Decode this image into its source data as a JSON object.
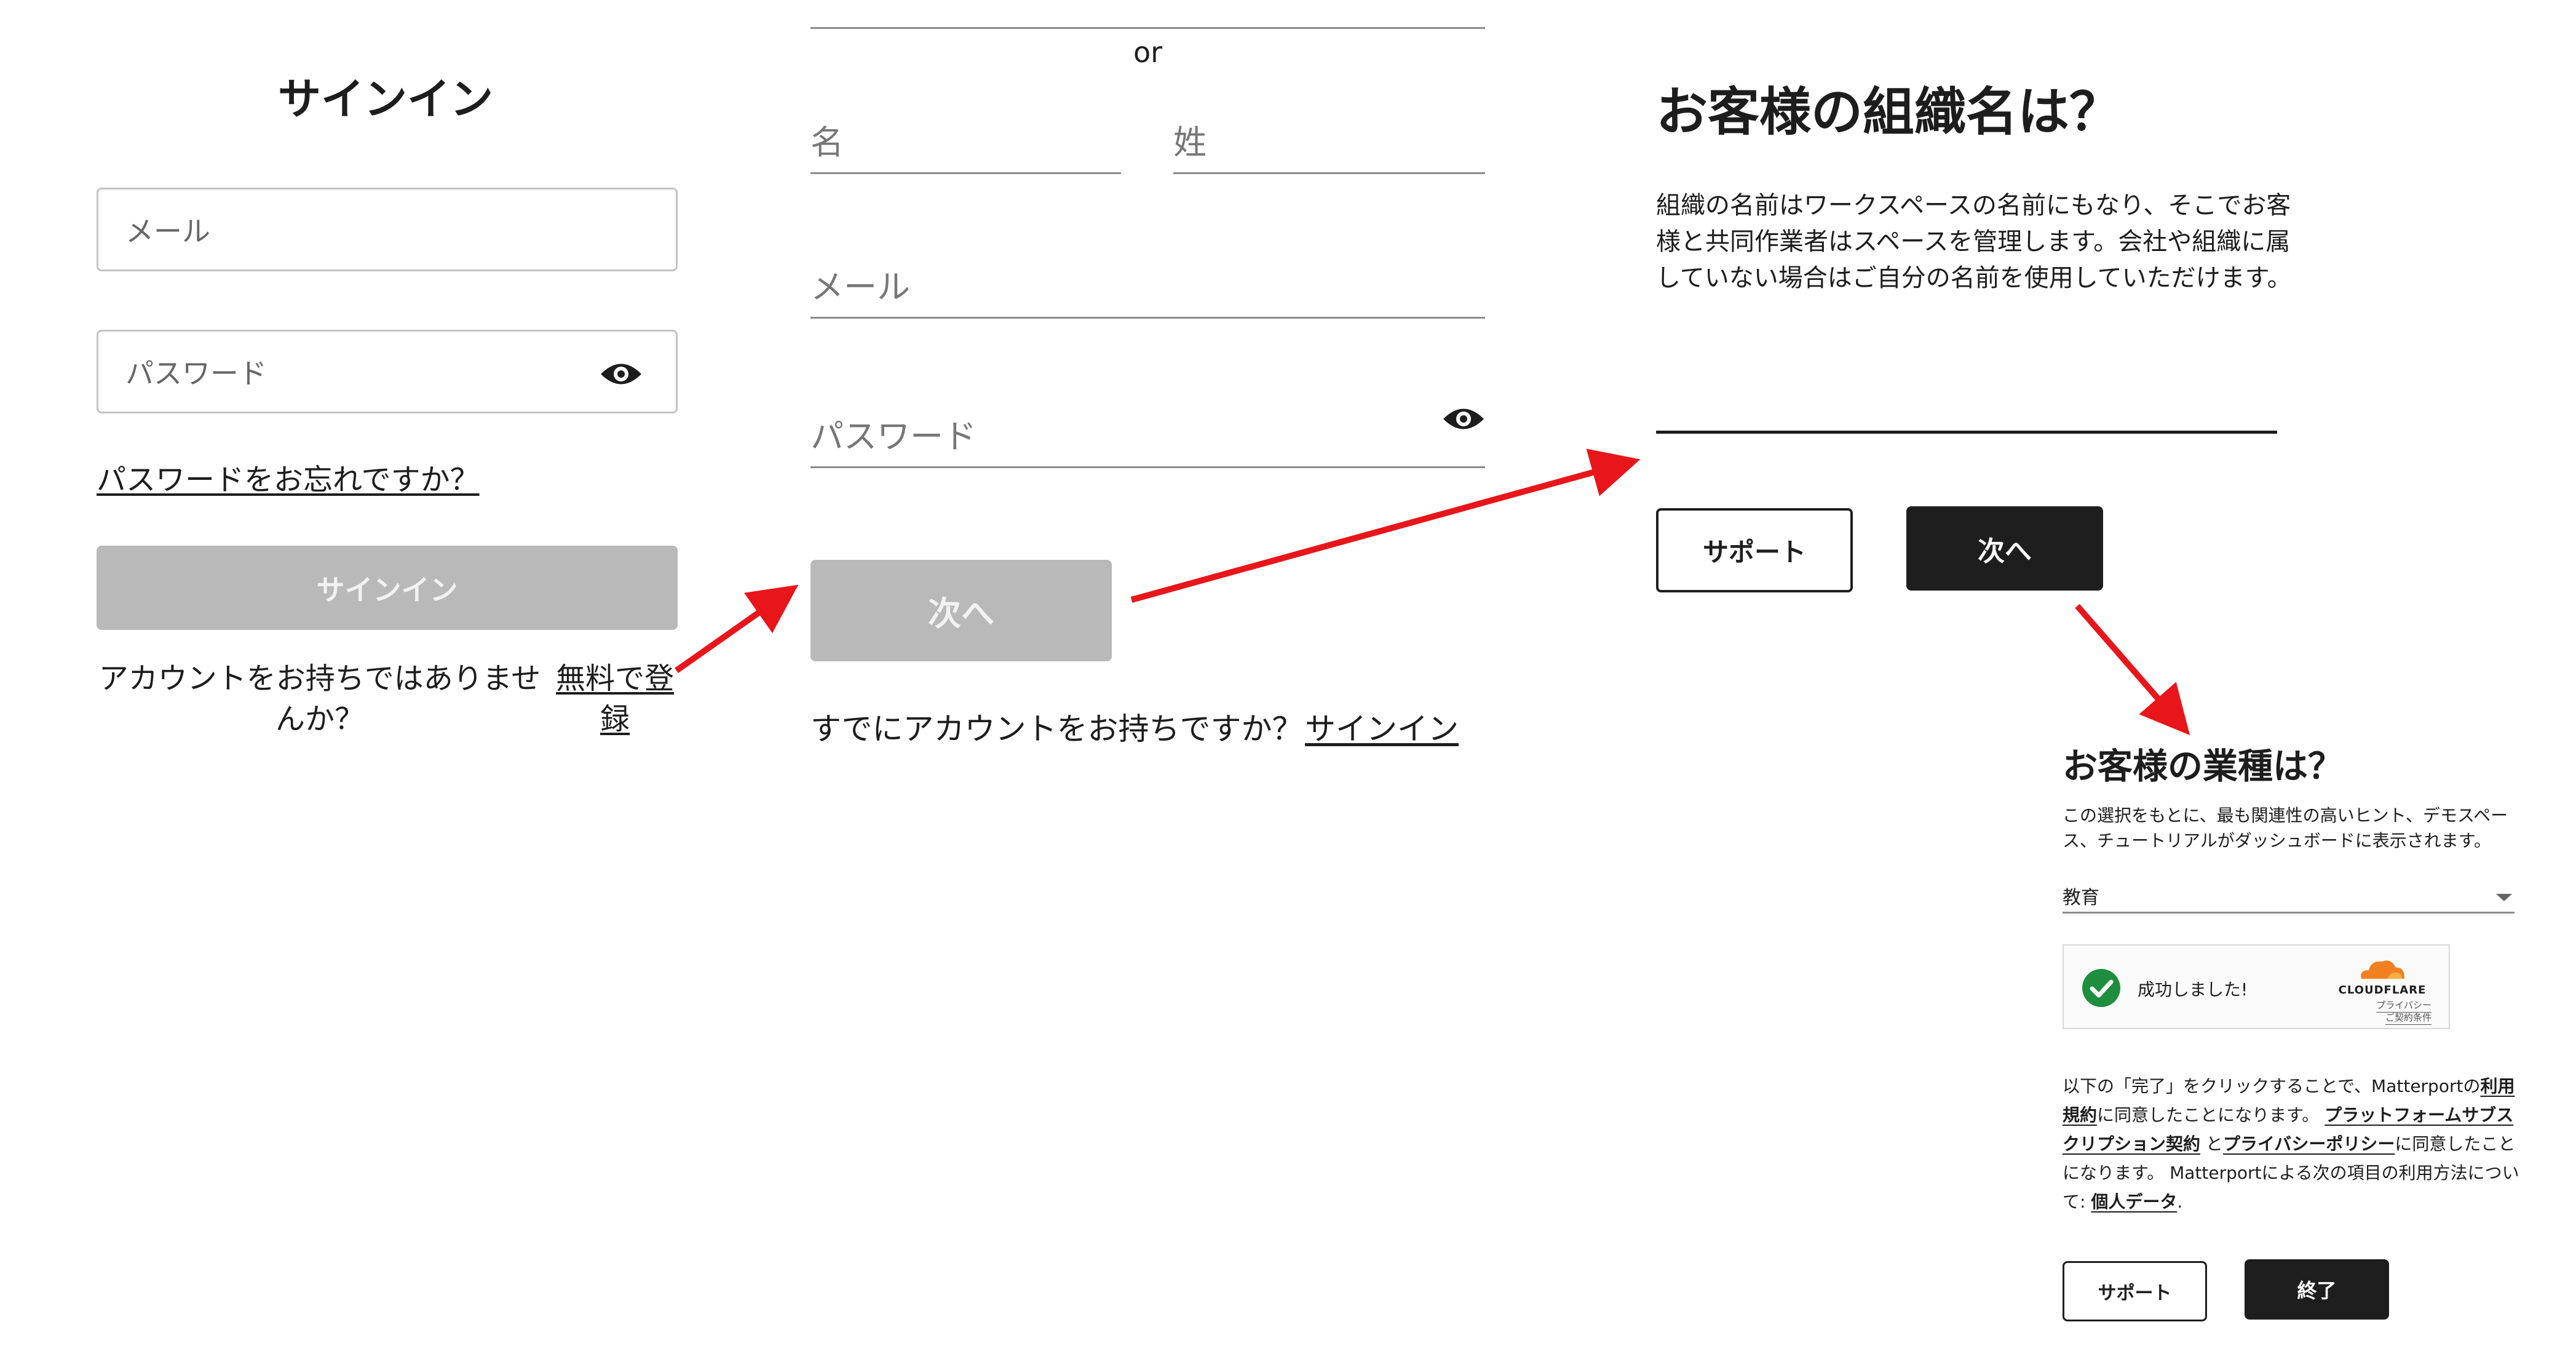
{
  "signin": {
    "title": "サインイン",
    "email_placeholder": "メール",
    "password_placeholder": "パスワード",
    "forgot_link": "パスワードをお忘れですか？",
    "signin_button": "サインイン",
    "no_account_text": "アカウントをお持ちではありませんか？",
    "register_link": "無料で登録"
  },
  "signup": {
    "or_label": "or",
    "first_name_placeholder": "名",
    "last_name_placeholder": "姓",
    "email_placeholder": "メール",
    "password_placeholder": "パスワード",
    "next_button": "次へ",
    "have_account_text": "すでにアカウントをお持ちですか？",
    "signin_link": "サインイン"
  },
  "org": {
    "title": "お客様の組織名は？",
    "description": "組織の名前はワークスペースの名前にもなり、そこでお客様と共同作業者はスペースを管理します。会社や組織に属していない場合はご自分の名前を使用していただけます。",
    "input_value": "",
    "support_button": "サポート",
    "next_button": "次へ"
  },
  "industry": {
    "title": "お客様の業種は？",
    "description": "この選択をもとに、最も関連性の高いヒント、デモスペース、チュートリアルがダッシュボードに表示されます。",
    "selected_value": "教育",
    "captcha": {
      "status": "成功しました!",
      "brand": "CLOUDFLARE",
      "privacy_link": "プライバシー",
      "terms_link": "ご契約条件"
    },
    "legal": {
      "t1": "以下の「完了」をクリックすることで、Matterportの",
      "l1": "利用規約",
      "t2": "に同意したことになります。",
      "l2": "プラットフォームサブスクリプション契約",
      "t3": "と",
      "l3": "プライバシーポリシー",
      "t4": "に同意したことになります。 Matterportによる次の項目の利用方法について: ",
      "l4": "個人データ",
      "t5": "."
    },
    "support_button": "サポート",
    "finish_button": "終了"
  },
  "colors": {
    "arrow": "#e8161b",
    "dark_button": "#1e1e1e",
    "disabled_button": "#b9b9b9",
    "success_green": "#1e8e3e",
    "cloudflare_orange": "#f38020"
  },
  "icons": [
    "eye-icon",
    "checkmark-icon",
    "cloudflare-logo-icon",
    "chevron-down-icon",
    "arrow-icon"
  ]
}
